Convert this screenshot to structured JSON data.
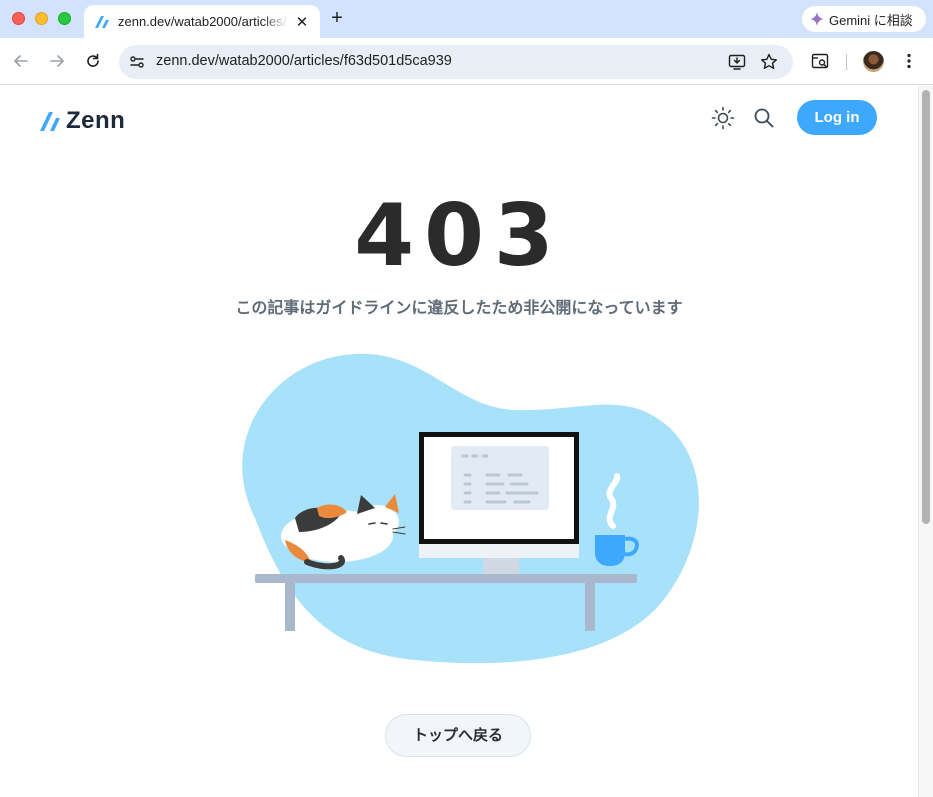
{
  "browser": {
    "tab_title": "zenn.dev/watab2000/articles/f63d501d5ca939",
    "tab_close": "✕",
    "new_tab": "+",
    "gemini_label": "Gemini に相談",
    "url": "zenn.dev/watab2000/articles/f63d501d5ca939"
  },
  "header": {
    "brand": "Zenn",
    "login_label": "Log in"
  },
  "error": {
    "code": "403",
    "message": "この記事はガイドラインに違反したため非公開になっています"
  },
  "home_button_label": "トップへ戻る",
  "colors": {
    "accent": "#3ea8ff",
    "blob": "#a8e1fa",
    "chrome_tabbar": "#d3e3fd",
    "heading": "#2b2b2b",
    "message": "#5f6b77"
  }
}
